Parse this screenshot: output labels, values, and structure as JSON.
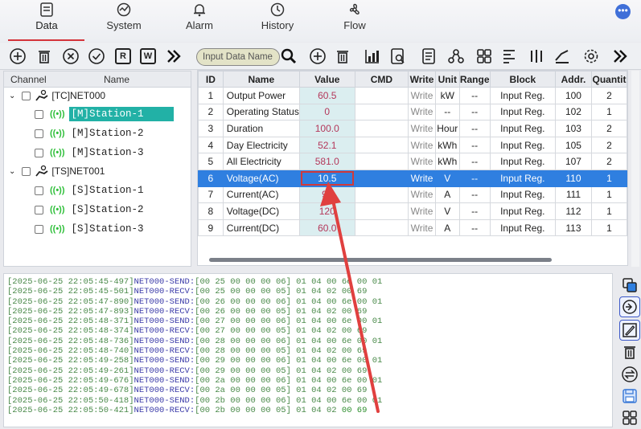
{
  "menu": [
    {
      "label": "Data",
      "icon": "data-icon"
    },
    {
      "label": "System",
      "icon": "system-icon"
    },
    {
      "label": "Alarm",
      "icon": "alarm-bell-icon"
    },
    {
      "label": "History",
      "icon": "history-icon"
    },
    {
      "label": "Flow",
      "icon": "flow-icon"
    }
  ],
  "notification": "•••",
  "toolbar": {
    "left_letters": [
      "R",
      "W"
    ],
    "search_placeholder": "Input Data Name"
  },
  "tree": {
    "headers": [
      "Channel",
      "Name"
    ],
    "nodes": [
      {
        "label": "[TC]NET000",
        "level": 0
      },
      {
        "label": "[M]Station-1",
        "level": 1,
        "selected": true
      },
      {
        "label": "[M]Station-2",
        "level": 1
      },
      {
        "label": "[M]Station-3",
        "level": 1
      },
      {
        "label": "[TS]NET001",
        "level": 0
      },
      {
        "label": "[S]Station-1",
        "level": 1
      },
      {
        "label": "[S]Station-2",
        "level": 1
      },
      {
        "label": "[S]Station-3",
        "level": 1
      }
    ]
  },
  "table": {
    "headers": [
      "ID",
      "Name",
      "Value",
      "CMD",
      "Write",
      "Unit",
      "Range",
      "Block",
      "Addr.",
      "Quantit"
    ],
    "rows": [
      [
        "1",
        "Output Power",
        "60.5",
        "",
        "Write",
        "kW",
        "--",
        "Input Reg.",
        "100",
        "2"
      ],
      [
        "2",
        "Operating Status",
        "0",
        "",
        "Write",
        "--",
        "--",
        "Input Reg.",
        "102",
        "1"
      ],
      [
        "3",
        "Duration",
        "100.0",
        "",
        "Write",
        "Hour",
        "--",
        "Input Reg.",
        "103",
        "2"
      ],
      [
        "4",
        "Day Electricity",
        "52.1",
        "",
        "Write",
        "kWh",
        "--",
        "Input Reg.",
        "105",
        "2"
      ],
      [
        "5",
        "All Electricity",
        "581.0",
        "",
        "Write",
        "kWh",
        "--",
        "Input Reg.",
        "107",
        "2"
      ],
      [
        "6",
        "Voltage(AC)",
        "10.5",
        "",
        "Write",
        "V",
        "--",
        "Input Reg.",
        "110",
        "1"
      ],
      [
        "7",
        "Current(AC)",
        "92",
        "",
        "Write",
        "A",
        "--",
        "Input Reg.",
        "111",
        "1"
      ],
      [
        "8",
        "Voltage(DC)",
        "120",
        "",
        "Write",
        "V",
        "--",
        "Input Reg.",
        "112",
        "1"
      ],
      [
        "9",
        "Current(DC)",
        "60.0",
        "",
        "Write",
        "A",
        "--",
        "Input Reg.",
        "113",
        "1"
      ]
    ],
    "highlighted_row": 6
  },
  "log": [
    {
      "ts": "[2025-06-25 22:05:45-497]",
      "tag": "NET000-SEND:",
      "hex": "[00 25 00 00 00 06] 01 04 00 6e 00 01"
    },
    {
      "ts": "[2025-06-25 22:05:45-501]",
      "tag": "NET000-RECV:",
      "hex": "[00 25 00 00 00 05] 01 04 02 00 69"
    },
    {
      "ts": "[2025-06-25 22:05:47-890]",
      "tag": "NET000-SEND:",
      "hex": "[00 26 00 00 00 06] 01 04 00 6e 00 01"
    },
    {
      "ts": "[2025-06-25 22:05:47-893]",
      "tag": "NET000-RECV:",
      "hex": "[00 26 00 00 00 05] 01 04 02 00 69"
    },
    {
      "ts": "[2025-06-25 22:05:48-371]",
      "tag": "NET000-SEND:",
      "hex": "[00 27 00 00 00 06] 01 04 00 6e 00 01"
    },
    {
      "ts": "[2025-06-25 22:05:48-374]",
      "tag": "NET000-RECV:",
      "hex": "[00 27 00 00 00 05] 01 04 02 00 69"
    },
    {
      "ts": "[2025-06-25 22:05:48-736]",
      "tag": "NET000-SEND:",
      "hex": "[00 28 00 00 00 06] 01 04 00 6e 00 01"
    },
    {
      "ts": "[2025-06-25 22:05:48-740]",
      "tag": "NET000-RECV:",
      "hex": "[00 28 00 00 00 05] 01 04 02 00 69"
    },
    {
      "ts": "[2025-06-25 22:05:49-258]",
      "tag": "NET000-SEND:",
      "hex": "[00 29 00 00 00 06] 01 04 00 6e 00 01"
    },
    {
      "ts": "[2025-06-25 22:05:49-261]",
      "tag": "NET000-RECV:",
      "hex": "[00 29 00 00 00 05] 01 04 02 00 69"
    },
    {
      "ts": "[2025-06-25 22:05:49-676]",
      "tag": "NET000-SEND:",
      "hex": "[00 2a 00 00 00 06] 01 04 00 6e 00 01"
    },
    {
      "ts": "[2025-06-25 22:05:49-678]",
      "tag": "NET000-RECV:",
      "hex": "[00 2a 00 00 00 05] 01 04 02 00 69"
    },
    {
      "ts": "[2025-06-25 22:05:50-418]",
      "tag": "NET000-SEND:",
      "hex": "[00 2b 00 00 00 06] 01 04 00 6e 00 01"
    },
    {
      "ts": "[2025-06-25 22:05:50-421]",
      "tag": "NET000-RECV:",
      "hex": "[00 2b 00 00 00 05] 01 04 02 ",
      "hex_hl": "00 69"
    }
  ],
  "colors": {
    "accent": "#2f7fe0",
    "selected_tree": "#22b1a6",
    "annotation": "#e0403f"
  }
}
